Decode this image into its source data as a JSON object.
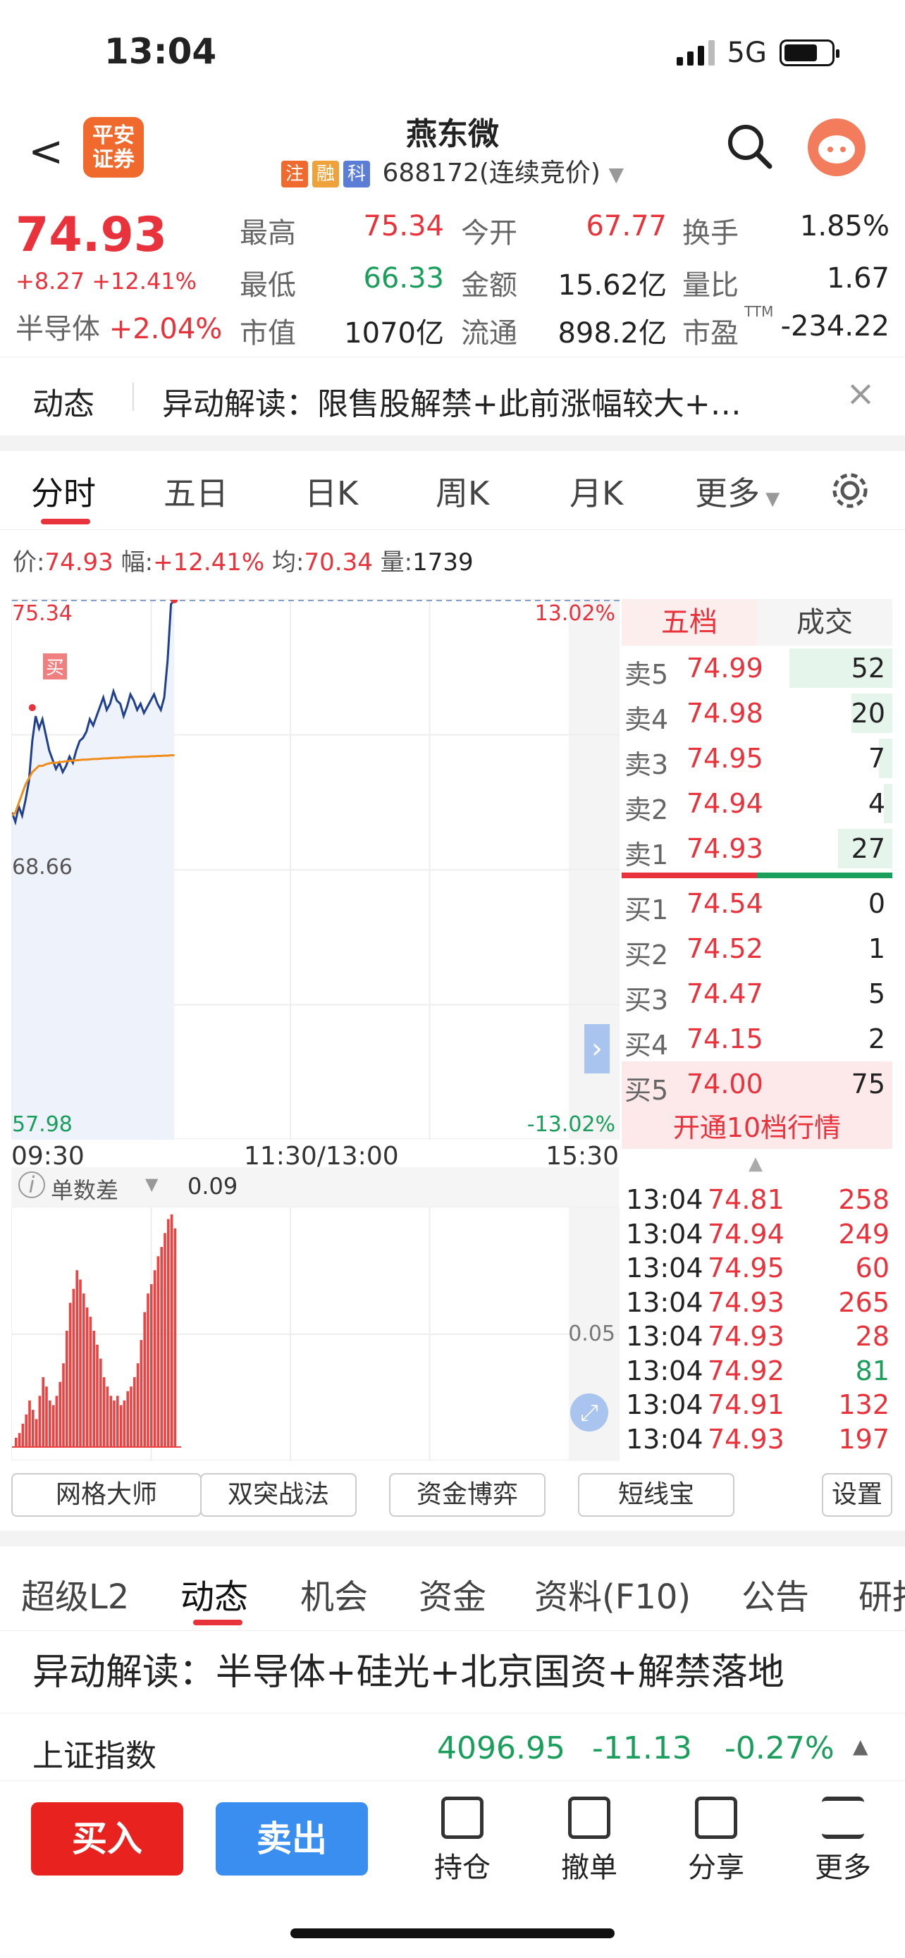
{
  "status": {
    "time": "13:04",
    "network": "5G"
  },
  "header": {
    "back_glyph": "<",
    "broker_logo": "平安证券",
    "stock_name": "燕东微",
    "tags": [
      "注",
      "融",
      "科"
    ],
    "tag_colors": [
      "#ef6a2c",
      "#f0a23a",
      "#5b7dd6"
    ],
    "code_line": "688172(连续竞价)",
    "search_icon": "search-icon",
    "assistant_icon": "assistant-avatar-icon"
  },
  "quote": {
    "price": "74.93",
    "change": "+8.27  +12.41%",
    "sector_name": "半导体",
    "sector_change": "+2.04%",
    "fields": [
      {
        "label": "最高",
        "value": "75.34",
        "color": "red"
      },
      {
        "label": "今开",
        "value": "67.77",
        "color": "red"
      },
      {
        "label": "换手",
        "value": "1.85%",
        "color": "dark"
      },
      {
        "label": "最低",
        "value": "66.33",
        "color": "green"
      },
      {
        "label": "金额",
        "value": "15.62亿",
        "color": "dark"
      },
      {
        "label": "量比",
        "value": "1.67",
        "color": "dark"
      },
      {
        "label": "市值",
        "value": "1070亿",
        "color": "dark"
      },
      {
        "label": "流通",
        "value": "898.2亿",
        "color": "dark"
      },
      {
        "label": "市盈",
        "sup": "TTM",
        "value": "-234.22",
        "color": "dark"
      }
    ]
  },
  "news_bar": {
    "label": "动态",
    "text": "异动解读：限售股解禁+此前涨幅较大+…",
    "close": "×"
  },
  "chart_tabs": [
    "分时",
    "五日",
    "日K",
    "周K",
    "月K",
    "更多"
  ],
  "stat_line": {
    "price_label": "价:",
    "price": "74.93",
    "amp_label": "幅:",
    "amp": "+12.41%",
    "avg_label": "均:",
    "avg": "70.34",
    "vol_label": "量:",
    "vol": "1739"
  },
  "chart_labels": {
    "top_left": "75.34",
    "top_right": "13.02%",
    "mid_left": "68.66",
    "bottom_left": "57.98",
    "bottom_right": "-13.02%",
    "buy_marker": "买",
    "expand": "›"
  },
  "chart_data": {
    "type": "line",
    "ylim": [
      57.98,
      75.34
    ],
    "x_labels": [
      "09:30",
      "11:30/13:00",
      "15:30"
    ],
    "series": [
      {
        "values": [
          68.5,
          68.2,
          68.7,
          68.4,
          68.9,
          69.5,
          70.8,
          71.6,
          71.2,
          71.5,
          71.0,
          70.5,
          70.2,
          69.9,
          70.1,
          69.8,
          70.0,
          70.3,
          70.1,
          70.5,
          70.8,
          70.9,
          71.1,
          71.5,
          71.3,
          71.6,
          71.9,
          72.2,
          71.8,
          72.0,
          72.4,
          72.1,
          72.0,
          71.6,
          71.9,
          72.3,
          72.1,
          71.8,
          72.0,
          71.7,
          71.9,
          72.1,
          72.3,
          72.0,
          71.8,
          72.2,
          73.4,
          75.2,
          75.34
        ]
      },
      {
        "values": [
          68.4,
          68.5,
          68.8,
          69.1,
          69.4,
          69.6,
          69.8,
          69.9,
          70.0,
          70.0,
          70.05,
          70.08,
          70.1,
          70.1,
          70.12,
          70.13,
          70.15,
          70.16,
          70.17,
          70.18,
          70.19,
          70.2,
          70.2,
          70.21,
          70.22,
          70.22,
          70.23,
          70.24,
          70.24,
          70.25,
          70.26,
          70.26,
          70.27,
          70.27,
          70.28,
          70.28,
          70.29,
          70.29,
          70.3,
          70.3,
          70.3,
          70.31,
          70.31,
          70.32,
          70.32,
          70.33,
          70.33,
          70.34,
          70.34
        ]
      }
    ]
  },
  "orderbook": {
    "tabs": [
      "五档",
      "成交"
    ],
    "asks": [
      {
        "label": "卖5",
        "price": "74.99",
        "vol": "52",
        "fill": 0.38
      },
      {
        "label": "卖4",
        "price": "74.98",
        "vol": "20",
        "fill": 0.15
      },
      {
        "label": "卖3",
        "price": "74.95",
        "vol": "7",
        "fill": 0.05
      },
      {
        "label": "卖2",
        "price": "74.94",
        "vol": "4",
        "fill": 0.03
      },
      {
        "label": "卖1",
        "price": "74.93",
        "vol": "27",
        "fill": 0.2
      }
    ],
    "bids": [
      {
        "label": "买1",
        "price": "74.54",
        "vol": "0"
      },
      {
        "label": "买2",
        "price": "74.52",
        "vol": "1"
      },
      {
        "label": "买3",
        "price": "74.47",
        "vol": "5"
      },
      {
        "label": "买4",
        "price": "74.15",
        "vol": "2"
      },
      {
        "label": "买5",
        "price": "74.00",
        "vol": "75"
      }
    ],
    "upgrade": "开通10档行情",
    "colors": {
      "ask_fill": "#e6f5ec",
      "bid_fill": "#fde9ea",
      "red": "#e8323c",
      "green": "#1a9e5c"
    }
  },
  "volume": {
    "label": "单数差",
    "value": "0.09",
    "axis_label": "0.05",
    "bars": [
      0.04,
      0.06,
      0.1,
      0.14,
      0.2,
      0.16,
      0.12,
      0.22,
      0.3,
      0.26,
      0.2,
      0.18,
      0.22,
      0.28,
      0.36,
      0.5,
      0.62,
      0.68,
      0.76,
      0.72,
      0.66,
      0.6,
      0.56,
      0.5,
      0.44,
      0.38,
      0.3,
      0.26,
      0.22,
      0.2,
      0.22,
      0.18,
      0.2,
      0.24,
      0.26,
      0.3,
      0.36,
      0.46,
      0.58,
      0.66,
      0.7,
      0.76,
      0.82,
      0.86,
      0.92,
      0.98,
      1.0,
      0.94
    ]
  },
  "ticks": [
    {
      "time": "13:04",
      "price": "74.81",
      "vol": "258",
      "vol_color": "red"
    },
    {
      "time": "13:04",
      "price": "74.94",
      "vol": "249",
      "vol_color": "red"
    },
    {
      "time": "13:04",
      "price": "74.95",
      "vol": "60",
      "vol_color": "red"
    },
    {
      "time": "13:04",
      "price": "74.93",
      "vol": "265",
      "vol_color": "red"
    },
    {
      "time": "13:04",
      "price": "74.93",
      "vol": "28",
      "vol_color": "red"
    },
    {
      "time": "13:04",
      "price": "74.92",
      "vol": "81",
      "vol_color": "green"
    },
    {
      "time": "13:04",
      "price": "74.91",
      "vol": "132",
      "vol_color": "red"
    },
    {
      "time": "13:04",
      "price": "74.93",
      "vol": "197",
      "vol_color": "red"
    }
  ],
  "tools": [
    "网格大师",
    "双突战法",
    "资金博弈",
    "短线宝",
    "设置"
  ],
  "info_tabs": [
    "超级L2",
    "动态",
    "机会",
    "资金",
    "资料(F10)",
    "公告",
    "研报"
  ],
  "news_headline": "异动解读：半导体+硅光+北京国资+解禁落地",
  "index": {
    "name": "上证指数",
    "value": "4096.95",
    "change": "-11.13",
    "pct": "-0.27%"
  },
  "bottom": {
    "buy": "买入",
    "sell": "卖出",
    "items": [
      "持仓",
      "撤单",
      "分享",
      "更多"
    ],
    "buy_color": "#e8221f",
    "sell_color": "#3a8ef0"
  }
}
